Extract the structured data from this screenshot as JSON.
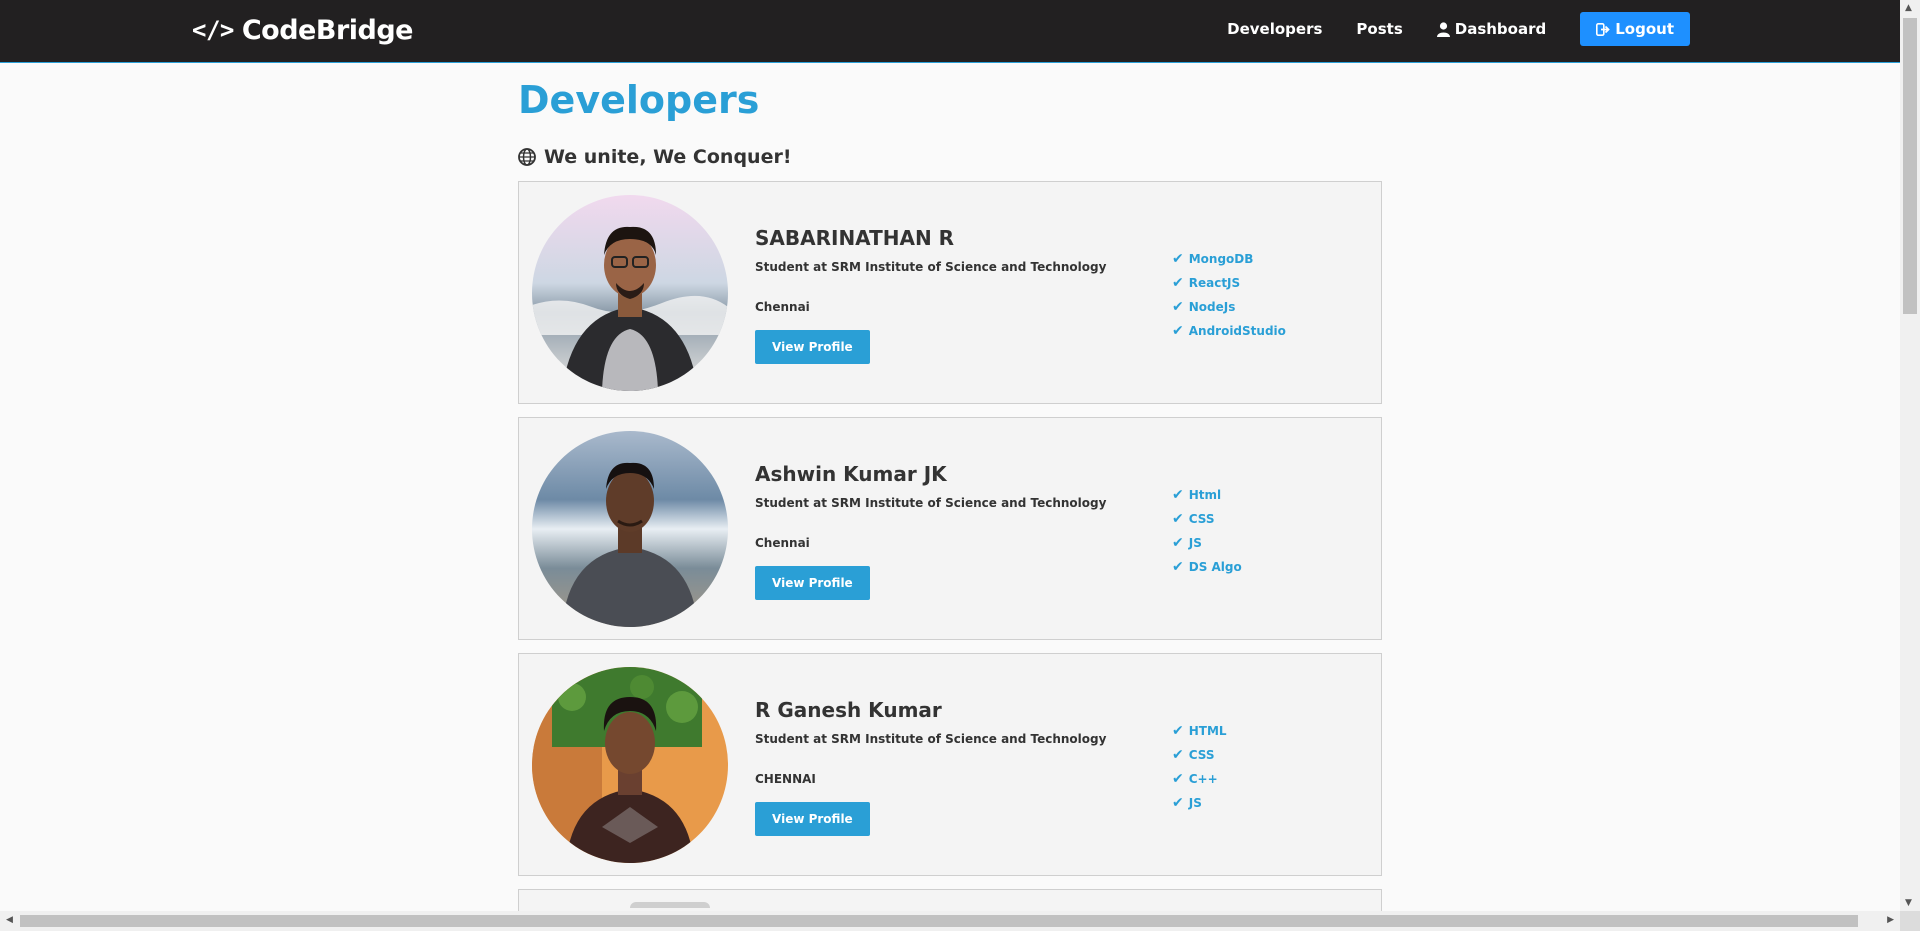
{
  "navbar": {
    "brand_icon": "</>",
    "brand": "CodeBridge",
    "links": {
      "developers": "Developers",
      "posts": "Posts",
      "dashboard": "Dashboard",
      "logout": "Logout"
    },
    "accent_color": "#1e90ff"
  },
  "page": {
    "title": "Developers",
    "lead": "We unite, We Conquer!",
    "accent_color": "#2a9fd6"
  },
  "profiles": [
    {
      "name": "SABARINATHAN R",
      "status": "Student at SRM Institute of Science and Technology",
      "location": "Chennai",
      "button": "View Profile",
      "skills": [
        "MongoDB",
        "ReactJS",
        "NodeJs",
        "AndroidStudio"
      ]
    },
    {
      "name": "Ashwin Kumar JK",
      "status": "Student at SRM Institute of Science and Technology",
      "location": "Chennai",
      "button": "View Profile",
      "skills": [
        "Html",
        "CSS",
        "JS",
        "DS Algo"
      ]
    },
    {
      "name": "R Ganesh Kumar",
      "status": "Student at SRM Institute of Science and Technology",
      "location": "CHENNAI",
      "button": "View Profile",
      "skills": [
        "HTML",
        "CSS",
        "C++",
        "JS"
      ]
    }
  ]
}
